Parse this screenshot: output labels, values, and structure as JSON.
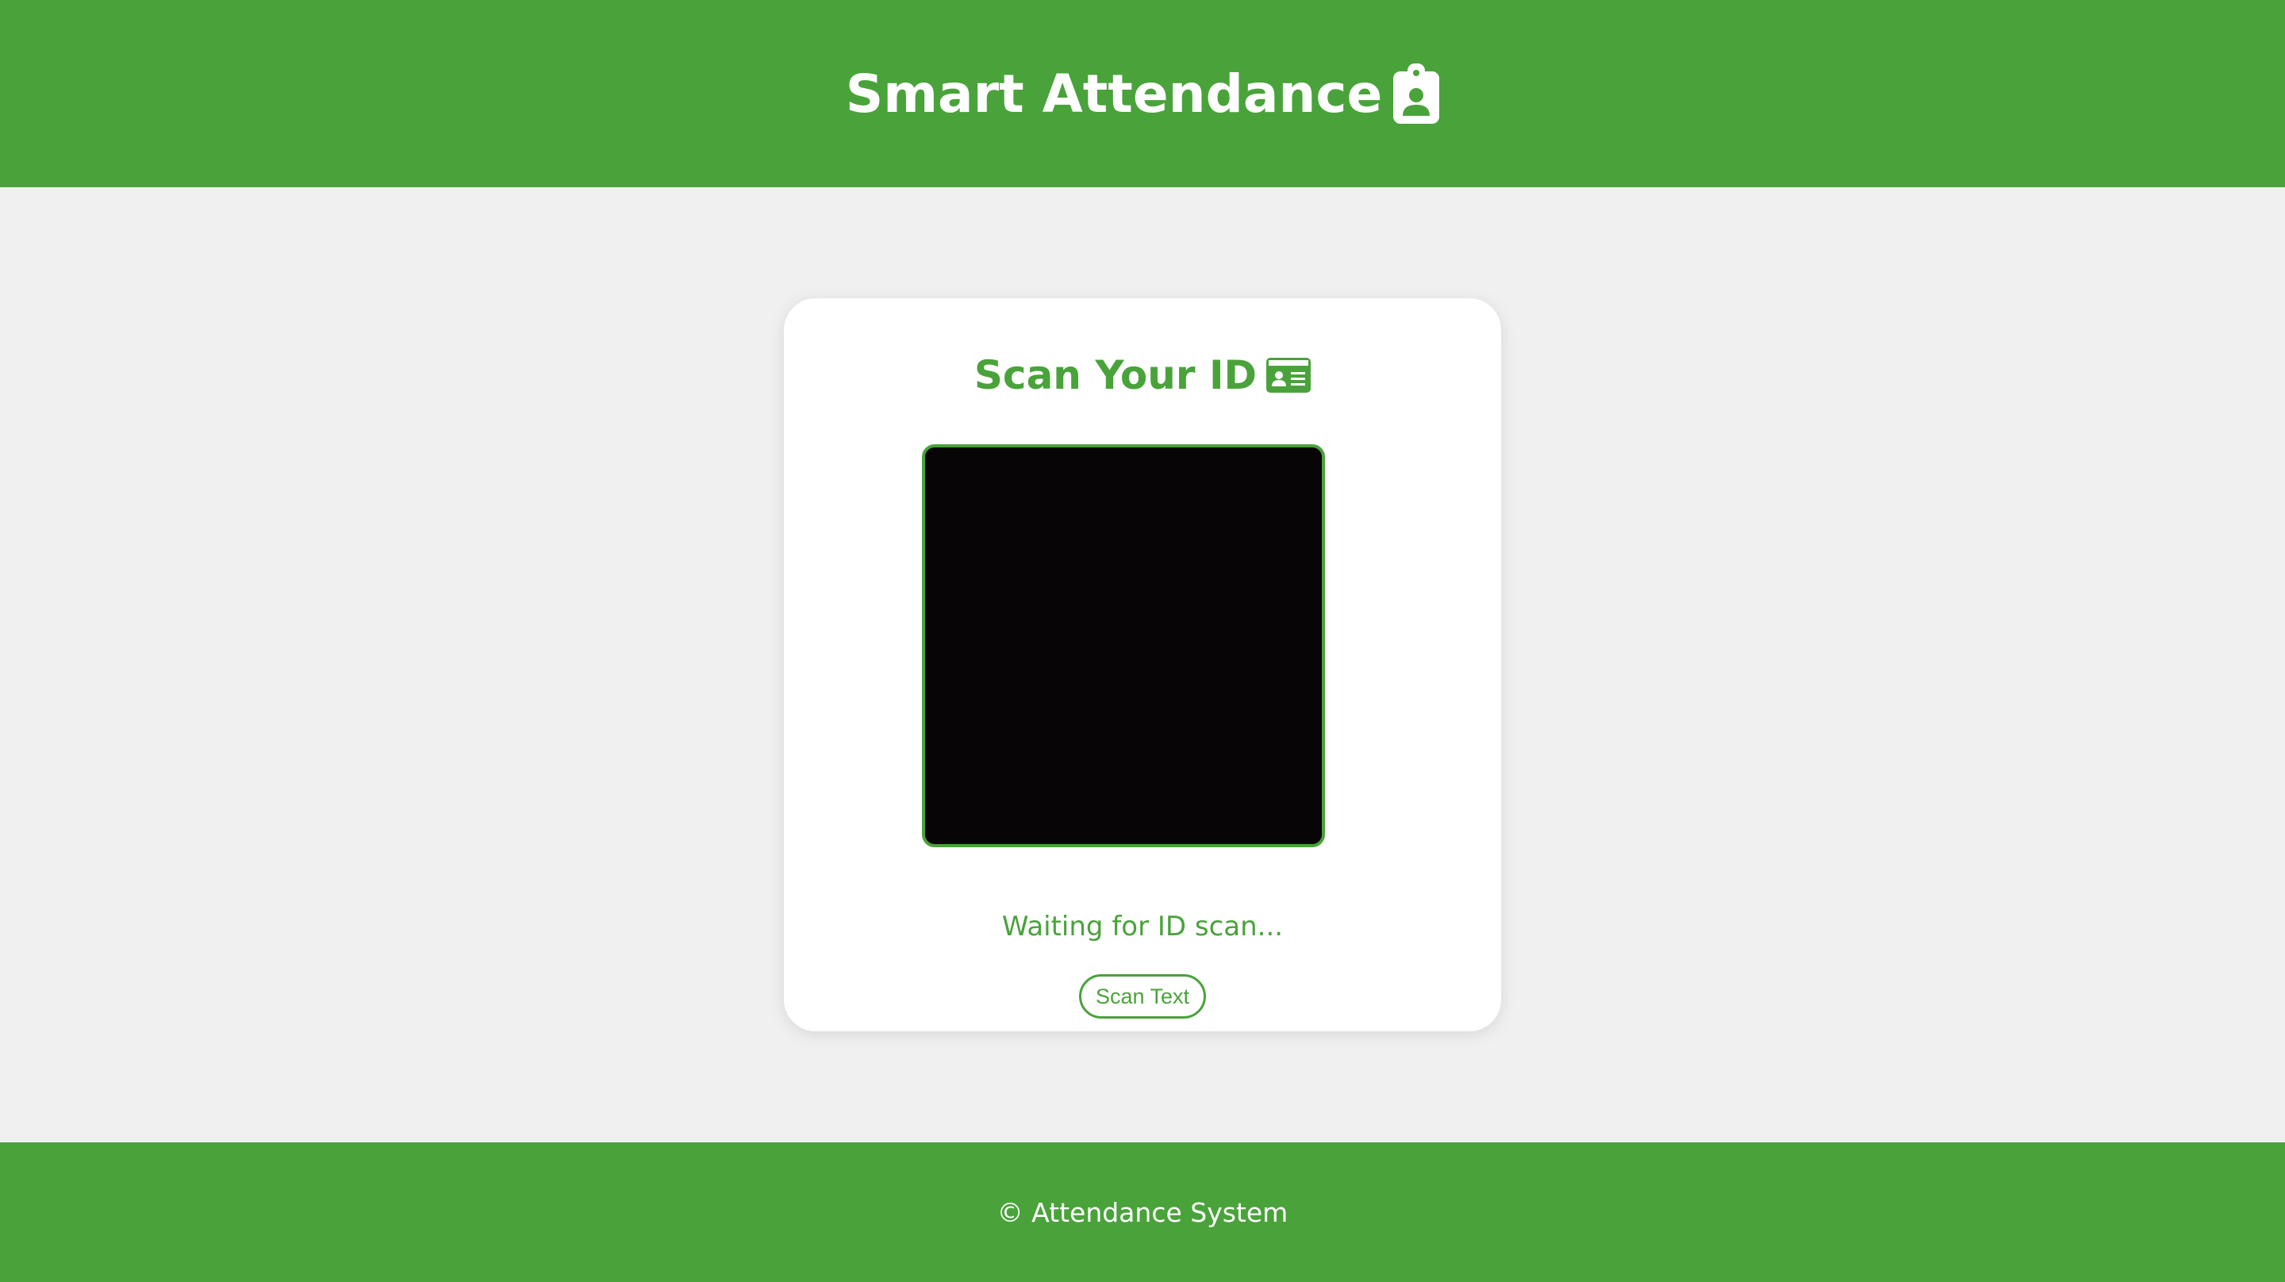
{
  "header": {
    "title": "Smart Attendance",
    "icon": "clipboard-user-icon"
  },
  "card": {
    "title": "Scan Your ID",
    "icon": "id-card-icon",
    "status": "Waiting for ID scan...",
    "scan_button_label": "Scan Text"
  },
  "footer": {
    "text": "© Attendance System"
  },
  "colors": {
    "accent": "#49a33a",
    "background": "#f0f0f0",
    "card": "#ffffff",
    "scanner": "#070505"
  }
}
